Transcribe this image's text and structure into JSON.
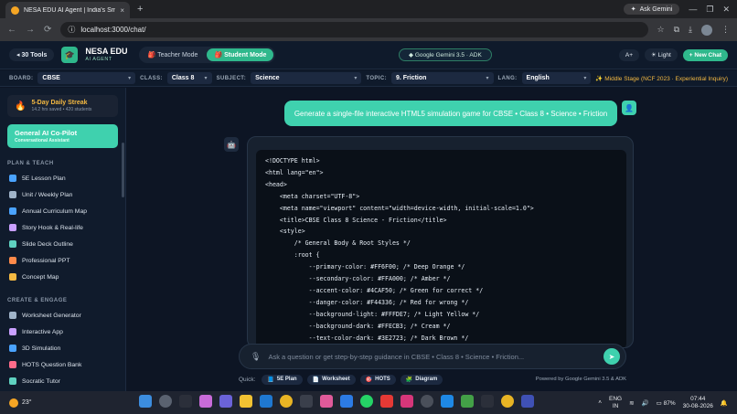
{
  "browser": {
    "tab_title": "NESA EDU AI Agent | India's Sm",
    "tab_close": "×",
    "new_tab": "+",
    "ask_gemini": "Ask Gemini",
    "url": "localhost:3000/chat/"
  },
  "header": {
    "tools_label": "30 Tools",
    "brand_name": "NESA EDU",
    "brand_sub": "AI AGENT",
    "teacher_mode": "Teacher Mode",
    "student_mode": "Student Mode",
    "model": "Google Gemini 3.5 · ADK",
    "font_size": "A+",
    "theme": "Light",
    "new_chat": "+ New Chat"
  },
  "filters": {
    "board_label": "BOARD:",
    "board": "CBSE",
    "class_label": "CLASS:",
    "class": "Class 8",
    "subject_label": "SUBJECT:",
    "subject": "Science",
    "topic_label": "TOPIC:",
    "topic": "9. Friction",
    "lang_label": "LANG:",
    "lang": "English",
    "stage": "Middle Stage (NCF 2023 · Experiential Inquiry)"
  },
  "sidebar": {
    "streak_title": "5-Day Daily Streak",
    "streak_sub": "14.2 hrs saved • 420 students",
    "copilot_title": "General AI Co-Pilot",
    "copilot_sub": "Conversational Assistant",
    "section_plan": "PLAN & TEACH",
    "plan_items": [
      {
        "label": "5E Lesson Plan",
        "color": "#4aa3ff"
      },
      {
        "label": "Unit / Weekly Plan",
        "color": "#9fb3c8"
      },
      {
        "label": "Annual Curriculum Map",
        "color": "#4aa3ff"
      },
      {
        "label": "Story Hook & Real-life",
        "color": "#c9a0ff"
      },
      {
        "label": "Slide Deck Outline",
        "color": "#5fd1c0"
      },
      {
        "label": "Professional PPT",
        "color": "#ff8a4a"
      },
      {
        "label": "Concept Map",
        "color": "#f4b942"
      }
    ],
    "section_create": "CREATE & ENGAGE",
    "create_items": [
      {
        "label": "Worksheet Generator",
        "color": "#9fb3c8"
      },
      {
        "label": "Interactive App",
        "color": "#c9a0ff"
      },
      {
        "label": "3D Simulation",
        "color": "#4aa3ff"
      },
      {
        "label": "HOTS Question Bank",
        "color": "#ff6b8a"
      },
      {
        "label": "Socratic Tutor",
        "color": "#5fd1c0"
      },
      {
        "label": "Emerging Learner",
        "color": "#f4b942"
      }
    ]
  },
  "chat": {
    "user_message": "Generate a single-file interactive HTML5 simulation game for CBSE • Class 8 • Science • Friction",
    "code_lines": [
      "<!DOCTYPE html>",
      "<html lang=\"en\">",
      "<head>",
      "    <meta charset=\"UTF-8\">",
      "    <meta name=\"viewport\" content=\"width=device-width, initial-scale=1.0\">",
      "    <title>CBSE Class 8 Science - Friction</title>",
      "    <style>",
      "        /* General Body & Root Styles */",
      "        :root {",
      "            --primary-color: #FF6F00; /* Deep Orange */",
      "            --secondary-color: #FFA000; /* Amber */",
      "            --accent-color: #4CAF50; /* Green for correct */",
      "            --danger-color: #F44336; /* Red for wrong */",
      "            --background-light: #FFFDE7; /* Light Yellow */",
      "            --background-dark: #FFECB3; /* Cream */",
      "            --text-color-dark: #3E2723; /* Dark Brown */"
    ],
    "input_placeholder": "Ask a question or get step-by-step guidance in CBSE • Class 8 • Science • Friction...",
    "quick_label": "Quick:",
    "quick_chips": [
      "5E Plan",
      "Worksheet",
      "HOTS",
      "Diagram"
    ],
    "powered_by": "Powered by Google Gemini 3.5 & ADK"
  },
  "taskbar": {
    "temperature": "23°",
    "lang_top": "ENG",
    "lang_bottom": "IN",
    "battery": "87%",
    "time": "07:44",
    "date": "30-08-2026"
  },
  "colors": {
    "accent": "#3fd1ae",
    "background": "#0d1524",
    "sidebar": "#101b2c",
    "stage_text": "#f4b942"
  }
}
